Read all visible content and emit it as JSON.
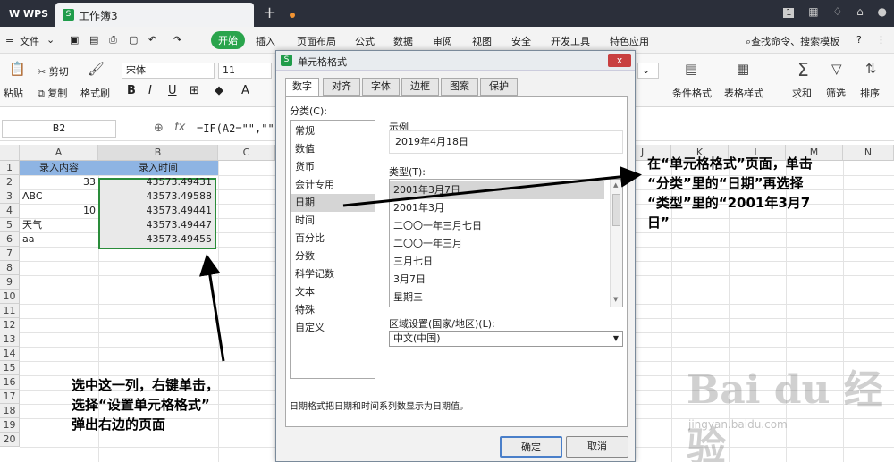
{
  "titlebar": {
    "app_label": "WPS",
    "doc_tab_label": "工作簿3",
    "doc_tab_icon": "S",
    "new_tab": "+",
    "tab_close": "×",
    "right_badge": "1"
  },
  "menubar": {
    "items": [
      "文件",
      "开始",
      "插入",
      "页面布局",
      "公式",
      "数据",
      "审阅",
      "视图",
      "安全",
      "开发工具",
      "特色应用"
    ],
    "search": "查找命令、搜索模板",
    "help": "?"
  },
  "ribbon": {
    "paste": "粘贴",
    "cut": "剪切",
    "copy": "复制",
    "format_painter": "格式刷",
    "font_name": "宋体",
    "font_size": "11",
    "bold": "B",
    "italic": "I",
    "underline": "U",
    "conditional_format": "条件格式",
    "table_style": "表格样式",
    "sum": "求和",
    "filter": "筛选",
    "sort": "排序"
  },
  "formulabar": {
    "cell_ref": "B2",
    "fx": "fx",
    "formula": "=IF(A2=\"\",\"\""
  },
  "grid": {
    "columns": [
      "A",
      "B",
      "C",
      "J",
      "K",
      "L",
      "M",
      "N"
    ],
    "rows": [
      "1",
      "2",
      "3",
      "4",
      "5",
      "6",
      "7",
      "8",
      "9",
      "10",
      "11",
      "12",
      "13",
      "14",
      "15",
      "16",
      "17",
      "18",
      "19",
      "20"
    ],
    "header_a": "录入内容",
    "header_b": "录入时间",
    "a_values": [
      "33",
      "ABC",
      "10",
      "天气",
      "aa"
    ],
    "b_values": [
      "43573.49431",
      "43573.49588",
      "43573.49441",
      "43573.49447",
      "43573.49455"
    ]
  },
  "dialog": {
    "title": "单元格格式",
    "title_icon": "S",
    "close": "x",
    "tabs": [
      "数字",
      "对齐",
      "字体",
      "边框",
      "图案",
      "保护"
    ],
    "category_label": "分类(C):",
    "categories": [
      "常规",
      "数值",
      "货币",
      "会计专用",
      "日期",
      "时间",
      "百分比",
      "分数",
      "科学记数",
      "文本",
      "特殊",
      "自定义"
    ],
    "selected_category": "日期",
    "sample_label": "示例",
    "sample_value": "2019年4月18日",
    "type_label": "类型(T):",
    "types": [
      "2001年3月7日",
      "2001年3月",
      "二〇〇一年三月七日",
      "二〇〇一年三月",
      "三月七日",
      "3月7日",
      "星期三"
    ],
    "locale_label": "区域设置(国家/地区)(L):",
    "locale_value": "中文(中国)",
    "description": "日期格式把日期和时间系列数显示为日期值。",
    "ok": "确定",
    "cancel": "取消"
  },
  "annotations": {
    "right_note": [
      "在“单元格格式”页面，单击",
      "“分类”里的“日期”再选择",
      "“类型”里的“2001年3月7",
      "日”"
    ],
    "left_note": [
      "选中这一列，右键单击，",
      "选择“设置单元格格式”",
      "弹出右边的页面"
    ],
    "watermark": "Bai du 经验",
    "watermark_url": "jingyan.baidu.com"
  }
}
